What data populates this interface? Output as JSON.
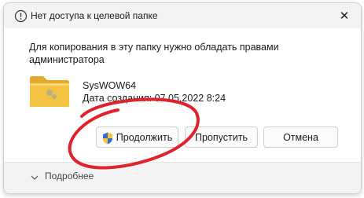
{
  "window": {
    "title": "Нет доступа к целевой папке",
    "close_glyph": "✕"
  },
  "message": "Для копирования в эту папку нужно обладать правами администратора",
  "item": {
    "name": "SysWOW64",
    "created": "Дата создания: 07.05.2022 8:24",
    "icon": "folder-icon"
  },
  "buttons": {
    "continue_label": "Продолжить",
    "continue_icon": "uac-shield-icon",
    "skip_label": "Пропустить",
    "cancel_label": "Отмена"
  },
  "footer": {
    "more_label": "Подробнее",
    "more_icon": "chevron-down-icon"
  },
  "colors": {
    "annotation_circle": "#e0222b",
    "folder": "#f5c342"
  }
}
